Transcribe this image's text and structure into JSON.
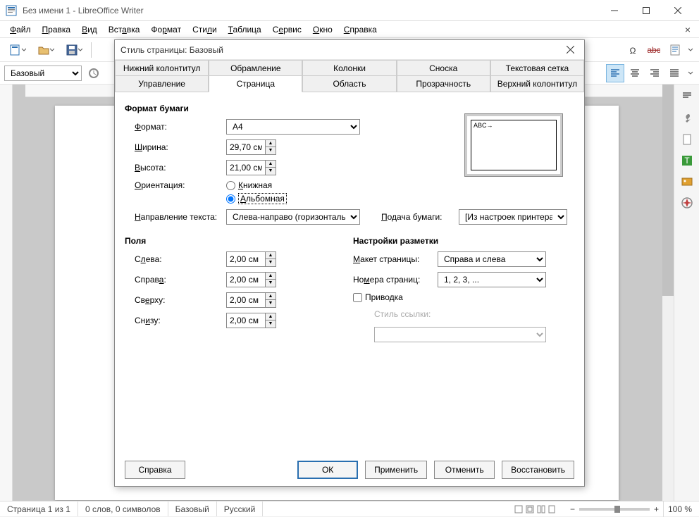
{
  "titlebar": {
    "title": "Без имени 1 - LibreOffice Writer"
  },
  "menubar": {
    "items": [
      "Файл",
      "Правка",
      "Вид",
      "Вставка",
      "Формат",
      "Стили",
      "Таблица",
      "Сервис",
      "Окно",
      "Справка"
    ],
    "underlines": [
      "Ф",
      "П",
      "В",
      "В",
      "Ф",
      "С",
      "Т",
      "С",
      "О",
      "С"
    ]
  },
  "styletoolbar": {
    "style_value": "Базовый"
  },
  "statusbar": {
    "page": "Страница 1 из 1",
    "words": "0 слов, 0 символов",
    "style": "Базовый",
    "lang": "Русский",
    "zoom": "100 %"
  },
  "dialog": {
    "title": "Стиль страницы: Базовый",
    "tabs_row1": [
      "Нижний колонтитул",
      "Обрамление",
      "Колонки",
      "Сноска",
      "Текстовая сетка"
    ],
    "tabs_row2": [
      "Управление",
      "Страница",
      "Область",
      "Прозрачность",
      "Верхний колонтитул"
    ],
    "active_tab": "Страница",
    "paper_format": {
      "section": "Формат бумаги",
      "format_label": "Формат:",
      "format_value": "A4",
      "width_label": "Ширина:",
      "width_value": "29,70 см",
      "height_label": "Высота:",
      "height_value": "21,00 см",
      "orientation_label": "Ориентация:",
      "orientation_portrait": "Книжная",
      "orientation_landscape": "Альбомная",
      "textdir_label": "Направление текста:",
      "textdir_value": "Слева-направо (горизонтально)",
      "tray_label": "Подача бумаги:",
      "tray_value": "[Из настроек принтера]",
      "preview_text": "ABC→"
    },
    "margins": {
      "section": "Поля",
      "left_label": "Слева:",
      "left_value": "2,00 см",
      "right_label": "Справа:",
      "right_value": "2,00 см",
      "top_label": "Сверху:",
      "top_value": "2,00 см",
      "bottom_label": "Снизу:",
      "bottom_value": "2,00 см"
    },
    "layout": {
      "section": "Настройки разметки",
      "pagelayout_label": "Макет страницы:",
      "pagelayout_value": "Справа и слева",
      "pagenum_label": "Номера страниц:",
      "pagenum_value": "1, 2, 3, ...",
      "register_label": "Приводка",
      "refstyle_label": "Стиль ссылки:",
      "refstyle_value": ""
    },
    "buttons": {
      "help": "Справка",
      "ok": "ОК",
      "apply": "Применить",
      "cancel": "Отменить",
      "reset": "Восстановить"
    }
  }
}
